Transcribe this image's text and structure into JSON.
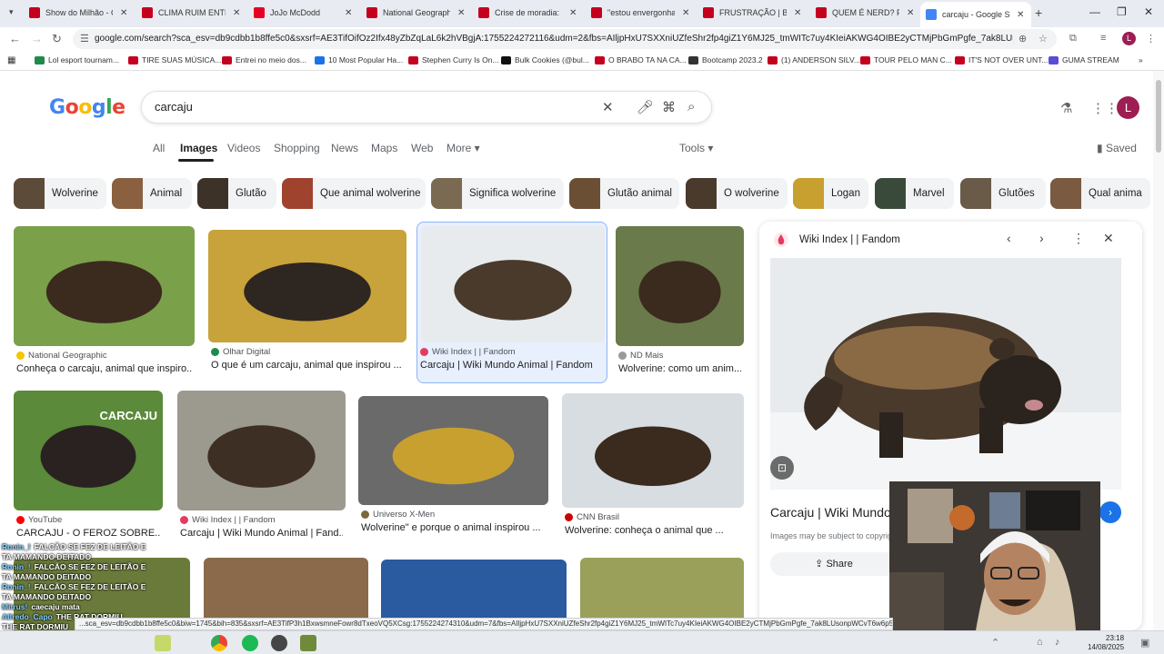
{
  "browser": {
    "tabs": [
      {
        "title": "Show do Milhão - Ce",
        "color": "#c4001d"
      },
      {
        "title": "CLIMA RUIM ENTRE C",
        "color": "#c4001d"
      },
      {
        "title": "JoJo McDodd",
        "color": "#e60023"
      },
      {
        "title": "National Geographic",
        "color": "#c4001d"
      },
      {
        "title": "Crise de moradia: bra",
        "color": "#c4001d"
      },
      {
        "title": "\"estou envergonhad",
        "color": "#c4001d"
      },
      {
        "title": "FRUSTRAÇÃO | Behin",
        "color": "#c4001d"
      },
      {
        "title": "QUEM É NERD? Ft. Pi",
        "color": "#c4001d"
      },
      {
        "title": "carcaju - Google Sea",
        "color": "#4285f4"
      }
    ],
    "url": "google.com/search?sca_esv=db9cdbb1b8ffe5c0&sxsrf=AE3TifOifOz2Ifx48yZbZqLaL6k2hVBgjA:1755224272116&udm=2&fbs=AIljpHxU7SXXniUZfeShr2fp4giZ1Y6MJ25_tmWITc7uy4KIeiAKWG4OIBE2yCTMjPbGmPgfe_7ak8LUsonpWCvT6w6p50G...",
    "profile_initial": "L",
    "bookmarks": [
      {
        "label": "Lol esport tournam...",
        "color": "#1f8a4c"
      },
      {
        "label": "TIRE SUAS MÚSICA...",
        "color": "#c4001d"
      },
      {
        "label": "Entrei no meio dos...",
        "color": "#c4001d"
      },
      {
        "label": "10 Most Popular Ha...",
        "color": "#1a73e8"
      },
      {
        "label": "Stephen Curry Is On...",
        "color": "#c4001d"
      },
      {
        "label": "Bulk Cookies (@bul...",
        "color": "#111111"
      },
      {
        "label": "O BRABO TA NA CA...",
        "color": "#c4001d"
      },
      {
        "label": "Bootcamp 2023.2",
        "color": "#333333"
      },
      {
        "label": "(1) ANDERSON SILV...",
        "color": "#c4001d"
      },
      {
        "label": "TOUR PELO MAN C...",
        "color": "#c4001d"
      },
      {
        "label": "IT'S NOT OVER UNT...",
        "color": "#c4001d"
      },
      {
        "label": "GUMA STREAM",
        "color": "#5b4bd6"
      }
    ]
  },
  "search": {
    "logo": "Google",
    "query": "carcaju",
    "tabs": [
      "All",
      "Images",
      "Videos",
      "Shopping",
      "News",
      "Maps",
      "Web",
      "More ▾"
    ],
    "tools": "Tools ▾",
    "saved": "Saved",
    "chips": [
      "Wolverine",
      "Animal",
      "Glutão",
      "Que animal wolverine",
      "Significa wolverine",
      "Glutão animal",
      "O wolverine",
      "Logan",
      "Marvel",
      "Glutões",
      "Qual anima"
    ]
  },
  "results": [
    {
      "source": "National Geographic",
      "title": "Conheça o carcaju, animal que inspiro...",
      "src_color": "#f5c400"
    },
    {
      "source": "Olhar Digital",
      "title": "O que é um carcaju, animal que inspirou ...",
      "src_color": "#1f8a4c"
    },
    {
      "source": "Wiki Index | | Fandom",
      "title": "Carcaju | Wiki Mundo Animal | Fandom",
      "src_color": "#e23c61"
    },
    {
      "source": "ND Mais",
      "title": "Wolverine: como um anim...",
      "src_color": "#999999"
    },
    {
      "source": "YouTube",
      "title": "CARCAJU - O FEROZ SOBRE...",
      "src_color": "#ff0000",
      "overlay": "CARCAJU"
    },
    {
      "source": "Wiki Index | | Fandom",
      "title": "Carcaju | Wiki Mundo Animal | Fand...",
      "src_color": "#e23c61"
    },
    {
      "source": "Universo X-Men",
      "title": "Wolverine\" e porque o animal inspirou ...",
      "src_color": "#7a6a3a"
    },
    {
      "source": "CNN Brasil",
      "title": "Wolverine: conheça o animal que ...",
      "src_color": "#cc0000"
    }
  ],
  "panel": {
    "site": "Wiki Index | | Fandom",
    "title": "Carcaju | Wiki Mundo A",
    "note": "Images may be subject to copyrig",
    "share": "Share",
    "lens": "⊡",
    "visit": "›"
  },
  "stream_chat": [
    {
      "user": "Ronin_!",
      "text": "FALCÃO SE FEZ DE LEITÃO E"
    },
    {
      "user": "",
      "text": "TA MAMANDO DEITADO"
    },
    {
      "user": "Ronin_!",
      "text": "FALCÃO SE FEZ DE LEITÃO E"
    },
    {
      "user": "",
      "text": "TA MAMANDO DEITADO"
    },
    {
      "user": "Ronin_!",
      "text": "FALCÃO SE FEZ DE LEITÃO E"
    },
    {
      "user": "",
      "text": "TA MAMANDO DEITADO"
    },
    {
      "user": "Mitrus!",
      "text": "caecaju mata"
    },
    {
      "user": "Alfredo_Capo",
      "text": "THE RAT DORMIU"
    },
    {
      "user": "",
      "text": "THE RAT DORMIU"
    }
  ],
  "statusbar": "...sca_esv=db9cdbb1b8ffe5c0&biw=1745&bih=835&sxsrf=AE3TifP3h1BxwsmneFowr8dTxeoVQ5XCsg:1755224274310&udm=7&fbs=AIljpHxU7SXXniUZfeShr2fp4giZ1Y6MJ25_tmWITc7uy4KIeiAKWG4OIBE2yCTMjPbGmPgfe_7ak8LUsonpWCvT6w6p50G...32tph...",
  "taskbar": {
    "time": "23:18",
    "date": "14/08/2025"
  }
}
